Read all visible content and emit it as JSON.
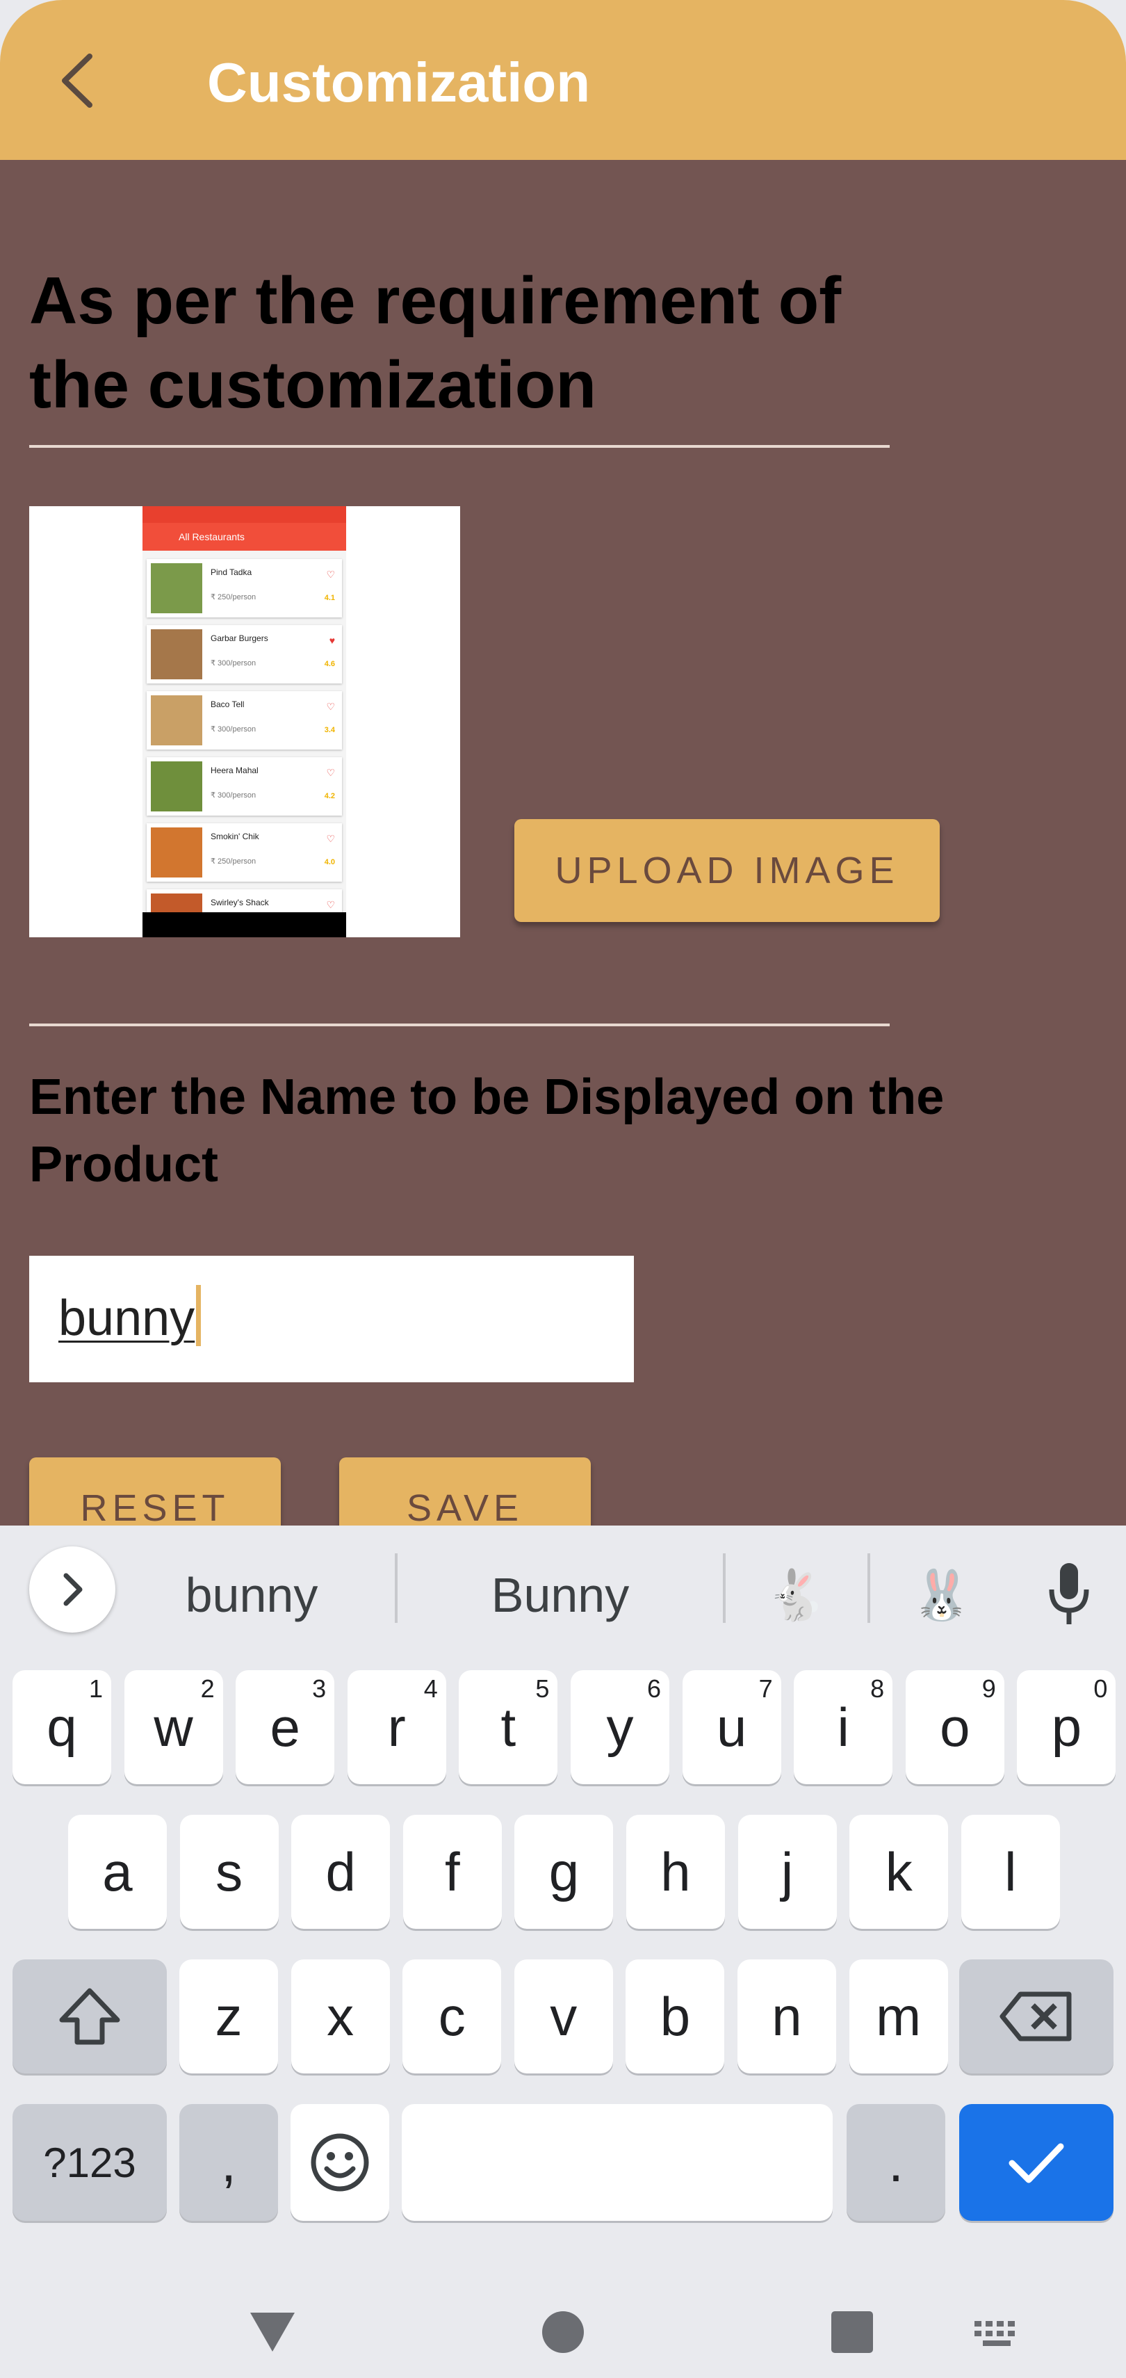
{
  "appbar": {
    "title": "Customization",
    "back_icon": "arrow-back-icon"
  },
  "main": {
    "heading": "As per the requirement of the customization",
    "preview": {
      "header_title": "All Restaurants",
      "items": [
        {
          "name": "Pind Tadka",
          "price": "₹ 250/person",
          "rating": "4.1",
          "favorite": false
        },
        {
          "name": "Garbar Burgers",
          "price": "₹ 300/person",
          "rating": "4.6",
          "favorite": true
        },
        {
          "name": "Baco Tell",
          "price": "₹ 300/person",
          "rating": "3.4",
          "favorite": false
        },
        {
          "name": "Heera Mahal",
          "price": "₹ 300/person",
          "rating": "4.2",
          "favorite": false
        },
        {
          "name": "Smokin' Chik",
          "price": "₹ 250/person",
          "rating": "4.0",
          "favorite": false
        },
        {
          "name": "Swirley's Shack",
          "price": "",
          "rating": "",
          "favorite": false
        }
      ]
    },
    "upload_label": "UPLOAD IMAGE",
    "name_heading": "Enter the Name to be Displayed on the Product",
    "name_value": "bunny",
    "reset_label": "RESET",
    "save_label": "SAVE"
  },
  "keyboard": {
    "suggestions": [
      "bunny",
      "Bunny"
    ],
    "emoji_suggestions": [
      "🐇",
      "🐰"
    ],
    "row1": [
      [
        "q",
        "1"
      ],
      [
        "w",
        "2"
      ],
      [
        "e",
        "3"
      ],
      [
        "r",
        "4"
      ],
      [
        "t",
        "5"
      ],
      [
        "y",
        "6"
      ],
      [
        "u",
        "7"
      ],
      [
        "i",
        "8"
      ],
      [
        "o",
        "9"
      ],
      [
        "p",
        "0"
      ]
    ],
    "row2": [
      "a",
      "s",
      "d",
      "f",
      "g",
      "h",
      "j",
      "k",
      "l"
    ],
    "row3": [
      "z",
      "x",
      "c",
      "v",
      "b",
      "n",
      "m"
    ],
    "symbols_label": "?123",
    "comma_label": ",",
    "period_label": ".",
    "accent_color": "#1a73e8"
  },
  "colors": {
    "appbar": "#e5b462",
    "content_bg": "#735552",
    "button": "#e5b462"
  }
}
